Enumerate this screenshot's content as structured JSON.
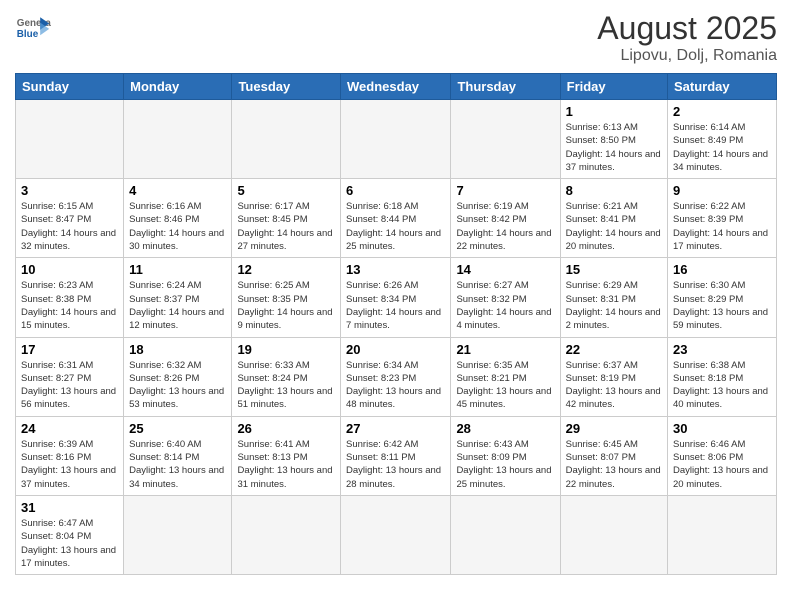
{
  "header": {
    "logo_general": "General",
    "logo_blue": "Blue",
    "month_year": "August 2025",
    "location": "Lipovu, Dolj, Romania"
  },
  "weekdays": [
    "Sunday",
    "Monday",
    "Tuesday",
    "Wednesday",
    "Thursday",
    "Friday",
    "Saturday"
  ],
  "weeks": [
    [
      {
        "day": "",
        "info": ""
      },
      {
        "day": "",
        "info": ""
      },
      {
        "day": "",
        "info": ""
      },
      {
        "day": "",
        "info": ""
      },
      {
        "day": "",
        "info": ""
      },
      {
        "day": "1",
        "info": "Sunrise: 6:13 AM\nSunset: 8:50 PM\nDaylight: 14 hours and 37 minutes."
      },
      {
        "day": "2",
        "info": "Sunrise: 6:14 AM\nSunset: 8:49 PM\nDaylight: 14 hours and 34 minutes."
      }
    ],
    [
      {
        "day": "3",
        "info": "Sunrise: 6:15 AM\nSunset: 8:47 PM\nDaylight: 14 hours and 32 minutes."
      },
      {
        "day": "4",
        "info": "Sunrise: 6:16 AM\nSunset: 8:46 PM\nDaylight: 14 hours and 30 minutes."
      },
      {
        "day": "5",
        "info": "Sunrise: 6:17 AM\nSunset: 8:45 PM\nDaylight: 14 hours and 27 minutes."
      },
      {
        "day": "6",
        "info": "Sunrise: 6:18 AM\nSunset: 8:44 PM\nDaylight: 14 hours and 25 minutes."
      },
      {
        "day": "7",
        "info": "Sunrise: 6:19 AM\nSunset: 8:42 PM\nDaylight: 14 hours and 22 minutes."
      },
      {
        "day": "8",
        "info": "Sunrise: 6:21 AM\nSunset: 8:41 PM\nDaylight: 14 hours and 20 minutes."
      },
      {
        "day": "9",
        "info": "Sunrise: 6:22 AM\nSunset: 8:39 PM\nDaylight: 14 hours and 17 minutes."
      }
    ],
    [
      {
        "day": "10",
        "info": "Sunrise: 6:23 AM\nSunset: 8:38 PM\nDaylight: 14 hours and 15 minutes."
      },
      {
        "day": "11",
        "info": "Sunrise: 6:24 AM\nSunset: 8:37 PM\nDaylight: 14 hours and 12 minutes."
      },
      {
        "day": "12",
        "info": "Sunrise: 6:25 AM\nSunset: 8:35 PM\nDaylight: 14 hours and 9 minutes."
      },
      {
        "day": "13",
        "info": "Sunrise: 6:26 AM\nSunset: 8:34 PM\nDaylight: 14 hours and 7 minutes."
      },
      {
        "day": "14",
        "info": "Sunrise: 6:27 AM\nSunset: 8:32 PM\nDaylight: 14 hours and 4 minutes."
      },
      {
        "day": "15",
        "info": "Sunrise: 6:29 AM\nSunset: 8:31 PM\nDaylight: 14 hours and 2 minutes."
      },
      {
        "day": "16",
        "info": "Sunrise: 6:30 AM\nSunset: 8:29 PM\nDaylight: 13 hours and 59 minutes."
      }
    ],
    [
      {
        "day": "17",
        "info": "Sunrise: 6:31 AM\nSunset: 8:27 PM\nDaylight: 13 hours and 56 minutes."
      },
      {
        "day": "18",
        "info": "Sunrise: 6:32 AM\nSunset: 8:26 PM\nDaylight: 13 hours and 53 minutes."
      },
      {
        "day": "19",
        "info": "Sunrise: 6:33 AM\nSunset: 8:24 PM\nDaylight: 13 hours and 51 minutes."
      },
      {
        "day": "20",
        "info": "Sunrise: 6:34 AM\nSunset: 8:23 PM\nDaylight: 13 hours and 48 minutes."
      },
      {
        "day": "21",
        "info": "Sunrise: 6:35 AM\nSunset: 8:21 PM\nDaylight: 13 hours and 45 minutes."
      },
      {
        "day": "22",
        "info": "Sunrise: 6:37 AM\nSunset: 8:19 PM\nDaylight: 13 hours and 42 minutes."
      },
      {
        "day": "23",
        "info": "Sunrise: 6:38 AM\nSunset: 8:18 PM\nDaylight: 13 hours and 40 minutes."
      }
    ],
    [
      {
        "day": "24",
        "info": "Sunrise: 6:39 AM\nSunset: 8:16 PM\nDaylight: 13 hours and 37 minutes."
      },
      {
        "day": "25",
        "info": "Sunrise: 6:40 AM\nSunset: 8:14 PM\nDaylight: 13 hours and 34 minutes."
      },
      {
        "day": "26",
        "info": "Sunrise: 6:41 AM\nSunset: 8:13 PM\nDaylight: 13 hours and 31 minutes."
      },
      {
        "day": "27",
        "info": "Sunrise: 6:42 AM\nSunset: 8:11 PM\nDaylight: 13 hours and 28 minutes."
      },
      {
        "day": "28",
        "info": "Sunrise: 6:43 AM\nSunset: 8:09 PM\nDaylight: 13 hours and 25 minutes."
      },
      {
        "day": "29",
        "info": "Sunrise: 6:45 AM\nSunset: 8:07 PM\nDaylight: 13 hours and 22 minutes."
      },
      {
        "day": "30",
        "info": "Sunrise: 6:46 AM\nSunset: 8:06 PM\nDaylight: 13 hours and 20 minutes."
      }
    ],
    [
      {
        "day": "31",
        "info": "Sunrise: 6:47 AM\nSunset: 8:04 PM\nDaylight: 13 hours and 17 minutes."
      },
      {
        "day": "",
        "info": ""
      },
      {
        "day": "",
        "info": ""
      },
      {
        "day": "",
        "info": ""
      },
      {
        "day": "",
        "info": ""
      },
      {
        "day": "",
        "info": ""
      },
      {
        "day": "",
        "info": ""
      }
    ]
  ]
}
